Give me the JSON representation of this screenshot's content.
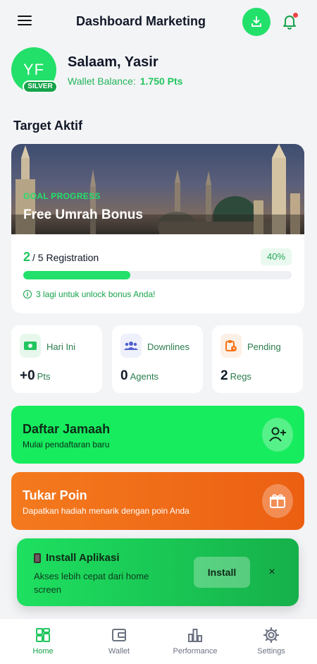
{
  "header": {
    "title": "Dashboard Marketing",
    "menu_icon": "menu-icon",
    "download_icon": "download-icon",
    "bell_icon": "bell-icon"
  },
  "profile": {
    "initials": "YF",
    "tier": "SILVER",
    "greeting": "Salaam, Yasir",
    "wallet_label": "Wallet Balance:",
    "wallet_value": "1.750 Pts"
  },
  "section_title": "Target Aktif",
  "goal": {
    "label": "GOAL PROGRESS",
    "name": "Free Umrah Bonus",
    "current": "2",
    "total_text": "/ 5 Registration",
    "percent_text": "40%",
    "progress": 0.4,
    "hint": "3 lagi untuk unlock bonus Anda!"
  },
  "stats": [
    {
      "label": "Hari Ini",
      "value": "+0",
      "unit": "Pts",
      "icon": "money-icon",
      "icon_bg": "#e7f7ec"
    },
    {
      "label": "Downlines",
      "value": "0",
      "unit": "Agents",
      "icon": "users-icon",
      "icon_bg": "#eef1fb"
    },
    {
      "label": "Pending",
      "value": "2",
      "unit": "Regs",
      "icon": "clipboard-clock-icon",
      "icon_bg": "#fdf0e6"
    }
  ],
  "actions": {
    "register": {
      "title": "Daftar Jamaah",
      "subtitle": "Mulai pendaftaran baru",
      "icon": "user-add-icon"
    },
    "redeem": {
      "title": "Tukar Poin",
      "subtitle": "Dapatkan hadiah menarik dengan poin Anda",
      "icon": "gift-icon"
    }
  },
  "install": {
    "title": "Install Aplikasi",
    "description": "Akses lebih cepat dari home screen",
    "button": "Install",
    "close": "×"
  },
  "nav": [
    {
      "label": "Home",
      "icon": "home-grid-icon",
      "active": true
    },
    {
      "label": "Wallet",
      "icon": "wallet-icon",
      "active": false
    },
    {
      "label": "Performance",
      "icon": "bar-chart-icon",
      "active": false
    },
    {
      "label": "Settings",
      "icon": "gear-icon",
      "active": false
    }
  ],
  "colors": {
    "brand_green": "#22e06a",
    "accent_orange": "#f47a1e",
    "badge_red": "#ef4444"
  }
}
